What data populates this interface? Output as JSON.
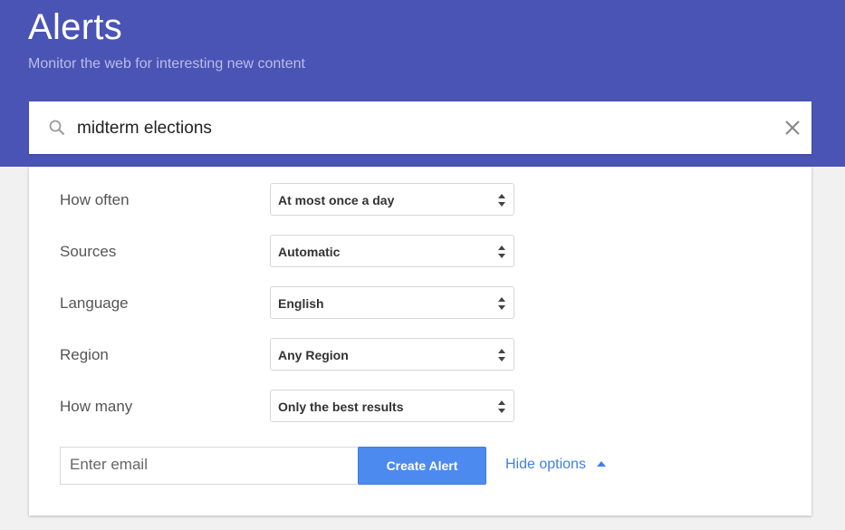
{
  "header": {
    "title": "Alerts",
    "subtitle": "Monitor the web for interesting new content"
  },
  "search": {
    "value": "midterm elections",
    "icon": "search-icon",
    "clear_icon": "close-icon"
  },
  "options": [
    {
      "label": "How often",
      "value": "At most once a day"
    },
    {
      "label": "Sources",
      "value": "Automatic"
    },
    {
      "label": "Language",
      "value": "English"
    },
    {
      "label": "Region",
      "value": "Any Region"
    },
    {
      "label": "How many",
      "value": "Only the best results"
    }
  ],
  "footer": {
    "email_placeholder": "Enter email",
    "email_value": "",
    "create_label": "Create Alert",
    "hide_label": "Hide options"
  },
  "colors": {
    "header_bg": "#4a54b4",
    "primary_button": "#4c8af0",
    "link": "#3f7fe6"
  }
}
